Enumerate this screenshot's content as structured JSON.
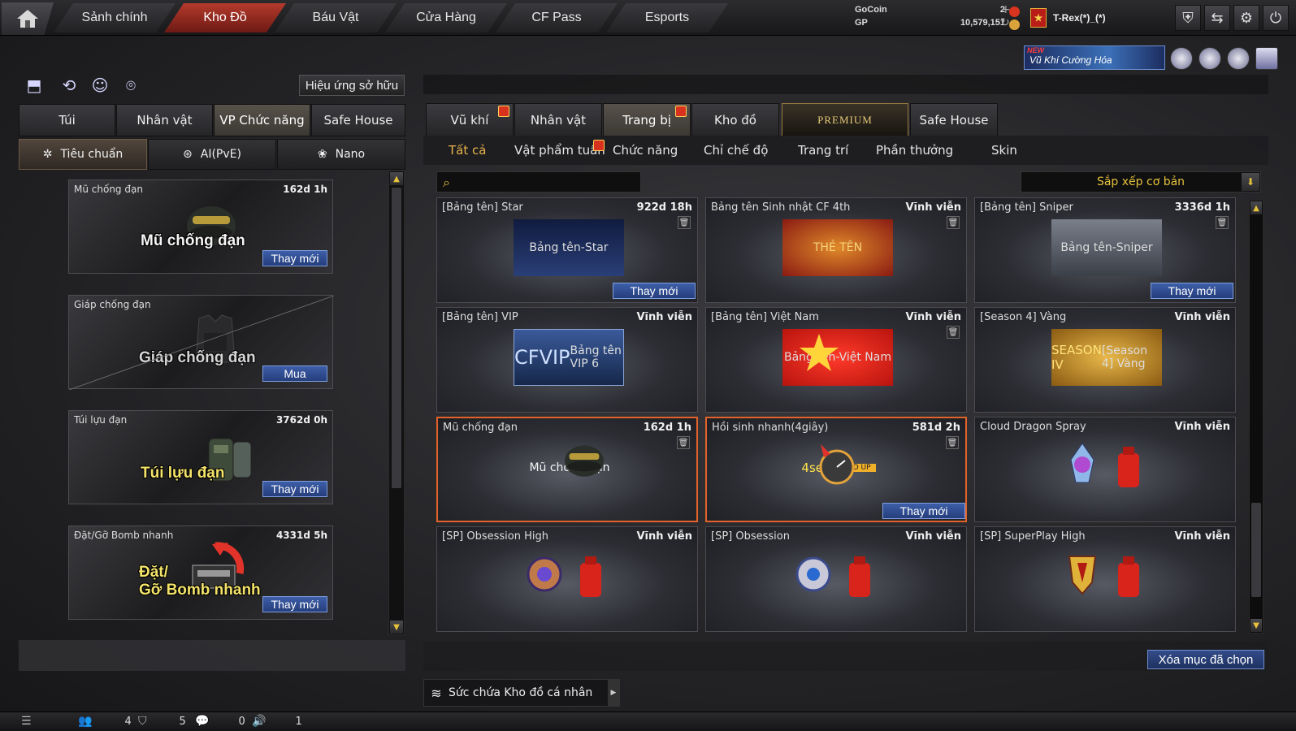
{
  "topnav": {
    "tabs": [
      {
        "label": "Sảnh chính"
      },
      {
        "label": "Kho Đồ"
      },
      {
        "label": "Báu Vật"
      },
      {
        "label": "Cửa Hàng"
      },
      {
        "label": "CF Pass"
      },
      {
        "label": "Esports"
      }
    ],
    "active_index": 1
  },
  "currency": {
    "gocoin_label": "GoCoin",
    "gocoin_value": "2",
    "gp_label": "GP",
    "gp_value": "10,579,151"
  },
  "user": {
    "name": "T-Rex(*)_(*)"
  },
  "promo": {
    "new_tag": "NEW",
    "banner_text": "Vũ Khí Cường Hóa"
  },
  "left_panel": {
    "owned_effect_button": "Hiệu ứng sở hữu",
    "tabs": [
      "Túi",
      "Nhân vật",
      "VP Chức năng",
      "Safe House"
    ],
    "active_tab": 2,
    "subtabs": [
      "Tiêu chuẩn",
      "AI(PvE)",
      "Nano"
    ],
    "active_subtab": 0,
    "items": [
      {
        "name": "Mũ chống đạn",
        "time": "162d 1h",
        "art_text": "Mũ chống đạn",
        "button": "Thay mới"
      },
      {
        "name": "Giáp chống đạn",
        "time": "",
        "art_text": "Giáp chống đạn",
        "button": "Mua"
      },
      {
        "name": "Túi lựu đạn",
        "time": "3762d 0h",
        "art_text": "Túi lựu đạn",
        "button": "Thay mới"
      },
      {
        "name": "Đặt/Gỡ Bomb nhanh",
        "time": "4331d 5h",
        "art_text_line1": "Đặt/",
        "art_text_line2": "Gỡ Bomb nhanh",
        "button": "Thay mới"
      }
    ]
  },
  "right_panel": {
    "tabs": [
      "Vũ khí",
      "Nhân vật",
      "Trang bị",
      "Kho đồ",
      "PREMIUM",
      "Safe House"
    ],
    "active_tab": 2,
    "subtabs": [
      "Tất cả",
      "Vật phẩm tuần",
      "Chức năng",
      "Chỉ chế độ",
      "Trang trí",
      "Phần thưởng",
      "Skin"
    ],
    "active_subtab": 0,
    "search_placeholder": "",
    "sort_label": "Sắp xếp cơ bản",
    "items": [
      {
        "name": "[Bảng tên] Star",
        "time": "922d 18h",
        "art_text": "Bảng tên-Star",
        "button": "Thay mới"
      },
      {
        "name": "Bảng tên Sinh nhật CF 4th",
        "time": "Vĩnh viễn",
        "art_text": "THẺ TÊN"
      },
      {
        "name": "[Bảng tên] Sniper",
        "time": "3336d 1h",
        "art_text": "Bảng tên-Sniper",
        "button": "Thay mới"
      },
      {
        "name": "[Bảng tên] VIP",
        "time": "Vĩnh viễn",
        "art_text": "Bảng tên VIP 6",
        "art_top": "CFVIP"
      },
      {
        "name": "[Bảng tên] Việt Nam",
        "time": "Vĩnh viễn",
        "art_text": "Bảng tên-Việt Nam"
      },
      {
        "name": "[Season 4] Vàng",
        "time": "Vĩnh viễn",
        "art_text": "[Season 4] Vàng",
        "art_top": "SEASON IV"
      },
      {
        "name": "Mũ chống đạn",
        "time": "162d 1h",
        "art_text": "Mũ chống đạn"
      },
      {
        "name": "Hồi sinh nhanh(4giây)",
        "time": "581d 2h",
        "art_top": "4sec",
        "art_text": "SPEED UP",
        "button": "Thay mới"
      },
      {
        "name": "Cloud Dragon Spray",
        "time": "Vĩnh viễn"
      },
      {
        "name": "[SP] Obsession High",
        "time": "Vĩnh viễn"
      },
      {
        "name": "[SP] Obsession",
        "time": "Vĩnh viễn"
      },
      {
        "name": "[SP] SuperPlay High",
        "time": "Vĩnh viễn"
      }
    ],
    "delete_button": "Xóa mục đã chọn",
    "capacity_label": "Sức chứa Kho đồ cá nhân"
  },
  "statusbar": {
    "friends_count": "4",
    "clan_count": "5",
    "chat_count": "0",
    "volume_count": "1"
  },
  "colors": {
    "accent_red": "#b53a2c",
    "button_blue": "#3d5ea8",
    "highlight_orange": "#e2632a",
    "gold": "#e6c23a"
  }
}
